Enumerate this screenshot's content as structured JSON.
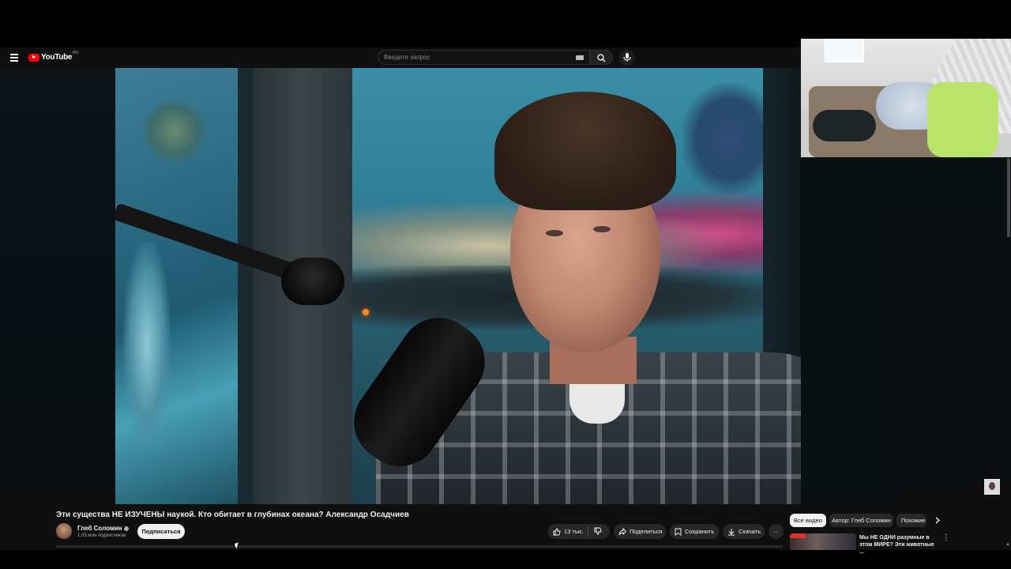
{
  "header": {
    "logo_text": "YouTube",
    "country_code": "RU",
    "search_placeholder": "Введите запрос"
  },
  "video": {
    "title": "Эти существа НЕ ИЗУЧЕНЫ наукой. Кто обитает в глубинах океана? Александр Осадчиев"
  },
  "channel": {
    "name": "Глеб Соломин",
    "subscribers": "1,05 млн подписчиков",
    "subscribe_label": "Подписаться"
  },
  "actions": {
    "likes": "13 тыс.",
    "share": "Поделиться",
    "save": "Сохранить",
    "download": "Скачать",
    "more": "···"
  },
  "chips": {
    "all": "Все видео",
    "author": "Автор: Глеб Соломин",
    "similar": "Похожие"
  },
  "recommendation": {
    "title": "Мы НЕ ОДНИ разумные в этом МИРЕ? Эти животные ...",
    "more": "⋮"
  },
  "colors": {
    "brand_red": "#ff0000",
    "background": "#0f0f0f",
    "pill_bg": "#272727"
  },
  "icons": [
    "menu-icon",
    "youtube-logo",
    "keyboard-icon",
    "search-icon",
    "mic-icon",
    "like-icon",
    "dislike-icon",
    "share-icon",
    "save-icon",
    "download-icon",
    "more-icon",
    "verified-icon",
    "chevron-right-icon"
  ]
}
